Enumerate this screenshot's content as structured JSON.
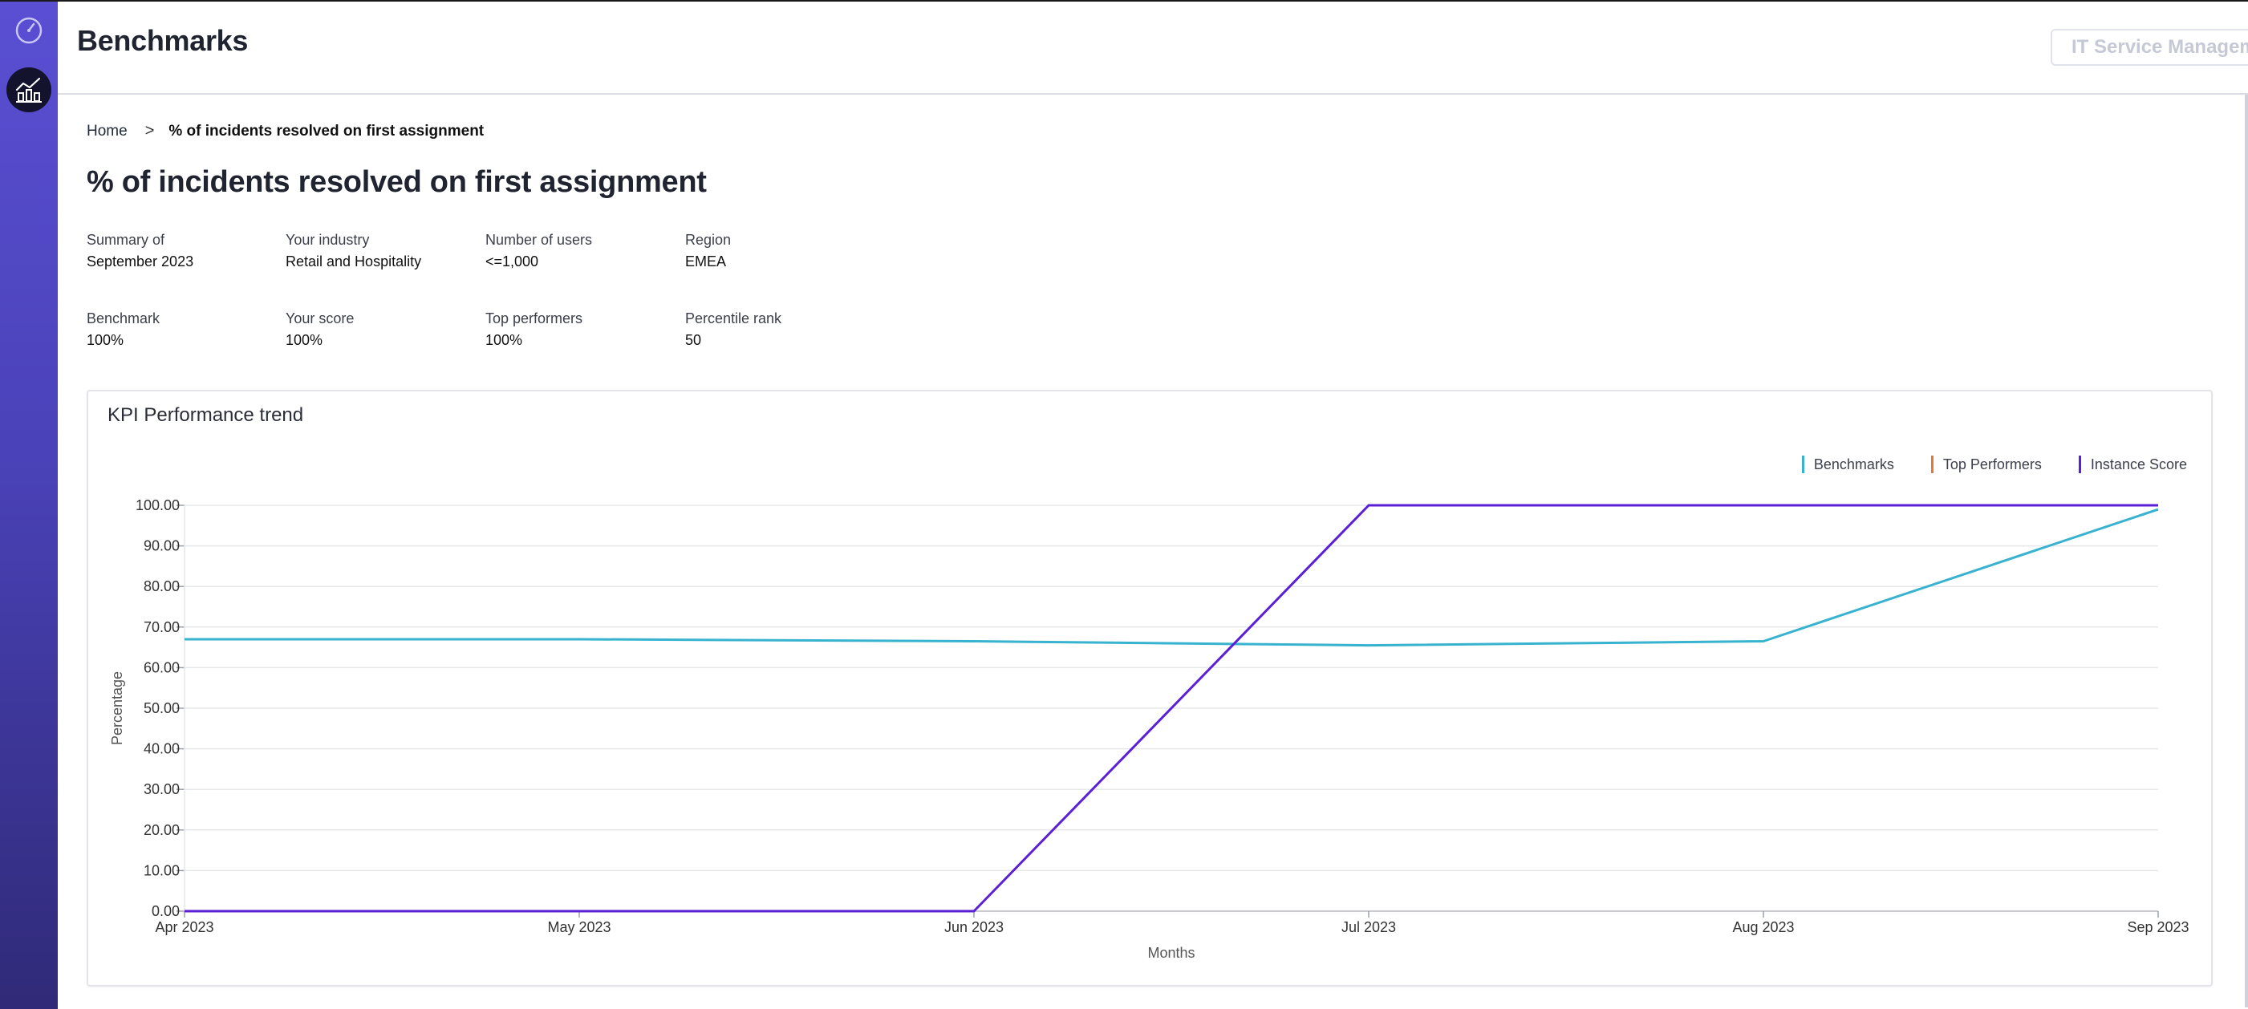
{
  "app": {
    "title": "Benchmarks",
    "scope_button": "IT Service Management"
  },
  "breadcrumb": {
    "home": "Home",
    "separator": ">",
    "current": "% of incidents resolved on first assignment"
  },
  "page_title": "% of incidents resolved on first assignment",
  "summary": [
    {
      "label": "Summary of",
      "value": "September 2023"
    },
    {
      "label": "Your industry",
      "value": "Retail and Hospitality"
    },
    {
      "label": "Number of users",
      "value": "<=1,000"
    },
    {
      "label": "Region",
      "value": "EMEA"
    },
    {
      "label": "Benchmark",
      "value": "100%"
    },
    {
      "label": "Your score",
      "value": "100%"
    },
    {
      "label": "Top performers",
      "value": "100%"
    },
    {
      "label": "Percentile rank",
      "value": "50"
    }
  ],
  "icons": {
    "sidebar_top": "speedometer-icon",
    "sidebar_active": "benchmark-chart-icon"
  },
  "colors": {
    "sidebar": "#5a4fd3",
    "benchmarks": "#38b3cf",
    "top_performers": "#e8773d",
    "instance_score": "#5b1fd6"
  },
  "chart_data": {
    "type": "line",
    "title": "KPI Performance trend",
    "xlabel": "Months",
    "ylabel": "Percentage",
    "x": [
      "Apr 2023",
      "May 2023",
      "Jun 2023",
      "Jul 2023",
      "Aug 2023",
      "Sep 2023"
    ],
    "yticks": [
      "0.00",
      "10.00",
      "20.00",
      "30.00",
      "40.00",
      "50.00",
      "60.00",
      "70.00",
      "80.00",
      "90.00",
      "100.00"
    ],
    "ylim": [
      0,
      100
    ],
    "grid": true,
    "legend_position": "top-right",
    "series": [
      {
        "name": "Benchmarks",
        "color": "#38b3cf",
        "values": [
          67.0,
          67.0,
          66.5,
          65.5,
          66.5,
          99.0
        ]
      },
      {
        "name": "Top Performers",
        "color": "#e8773d",
        "values": []
      },
      {
        "name": "Instance Score",
        "color": "#5b1fd6",
        "values": [
          0,
          0,
          0,
          100,
          100,
          100
        ]
      }
    ]
  }
}
